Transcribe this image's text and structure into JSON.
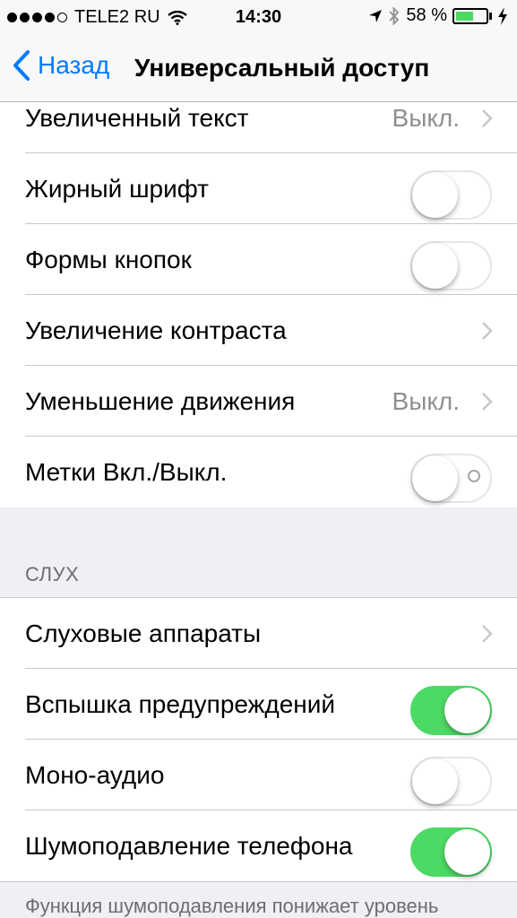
{
  "status_bar": {
    "carrier": "TELE2 RU",
    "time": "14:30",
    "battery_percent": "58 %",
    "battery_level": 0.58,
    "signal_bars_filled": 4,
    "signal_bars_total": 5
  },
  "nav": {
    "back_label": "Назад",
    "title": "Универсальный доступ"
  },
  "group1": {
    "rows": [
      {
        "label": "Увеличенный текст",
        "value": "Выкл.",
        "control": "chevron"
      },
      {
        "label": "Жирный шрифт",
        "control": "toggle",
        "on": false
      },
      {
        "label": "Формы кнопок",
        "control": "toggle",
        "on": false
      },
      {
        "label": "Увеличение контраста",
        "control": "chevron"
      },
      {
        "label": "Уменьшение движения",
        "value": "Выкл.",
        "control": "chevron"
      },
      {
        "label": "Метки Вкл./Выкл.",
        "control": "toggle",
        "on": false
      }
    ]
  },
  "section_hearing": {
    "header": "СЛУХ",
    "rows": [
      {
        "label": "Слуховые аппараты",
        "control": "chevron"
      },
      {
        "label": "Вспышка предупреждений",
        "control": "toggle",
        "on": true
      },
      {
        "label": "Моно-аудио",
        "control": "toggle",
        "on": false
      },
      {
        "label": "Шумоподавление телефона",
        "control": "toggle",
        "on": true
      }
    ],
    "footer": "Функция шумоподавления понижает уровень"
  },
  "colors": {
    "accent": "#007aff",
    "toggle_on": "#4cd964",
    "secondary_text": "#8e8e93"
  }
}
